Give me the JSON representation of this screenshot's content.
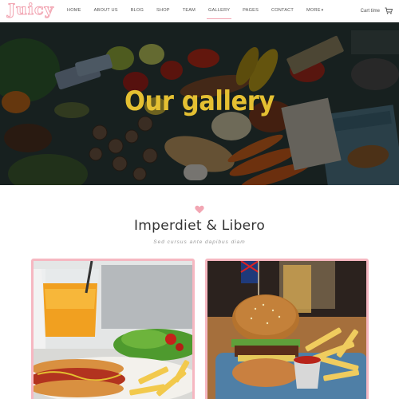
{
  "header": {
    "logo": "Juicy",
    "nav": [
      {
        "label": "HOME"
      },
      {
        "label": "ABOUT US"
      },
      {
        "label": "BLOG"
      },
      {
        "label": "SHOP"
      },
      {
        "label": "TEAM"
      },
      {
        "label": "GALLERY",
        "active": true
      },
      {
        "label": "PAGES"
      },
      {
        "label": "CONTACT"
      },
      {
        "label": "MORE"
      }
    ],
    "cart_label": "Cart time",
    "cart_icon": "cart-icon",
    "accent_color": "#f2a6b3"
  },
  "hero": {
    "title": "Our gallery",
    "title_color": "#e4c032"
  },
  "section": {
    "icon": "heart-icon",
    "title": "Imperdiet & Libero",
    "subtitle": "Sed cursus ante dapibus diam"
  },
  "gallery": {
    "border_color": "#f6b7c1"
  }
}
